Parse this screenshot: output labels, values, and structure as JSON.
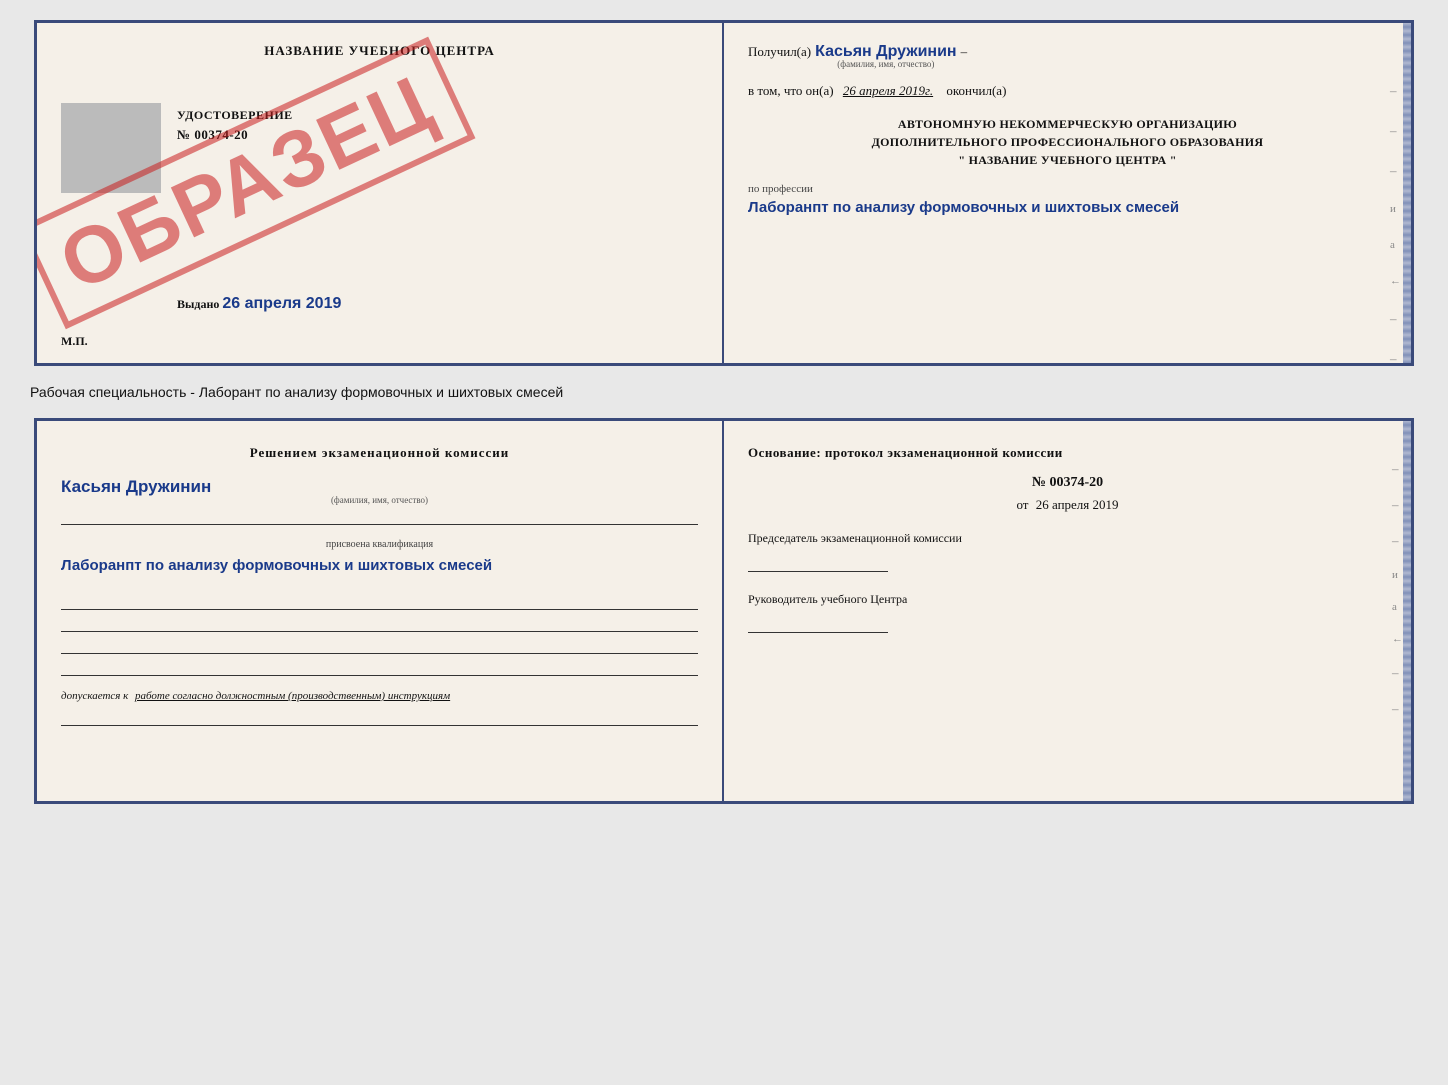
{
  "topDoc": {
    "left": {
      "title": "НАЗВАНИЕ УЧЕБНОГО ЦЕНТРА",
      "grayBox": true,
      "udostLabel": "УДОСТОВЕРЕНИЕ",
      "numberLabel": "№ 00374-20",
      "vydanoLabel": "Выдано",
      "vydanoDate": "26 апреля 2019",
      "mpLabel": "М.П.",
      "obrazets": "ОБРАЗЕЦ"
    },
    "right": {
      "poluchilLabel": "Получил(а)",
      "fio": "Касьян Дружинин",
      "fioSubLabel": "(фамилия, имя, отчество)",
      "dash": "–",
      "vtomLabel": "в том, что он(а)",
      "date": "26 апреля 2019г.",
      "okonchilLabel": "окончил(а)",
      "avtonom1": "АВТОНОМНУЮ НЕКОММЕРЧЕСКУЮ ОРГАНИЗАЦИЮ",
      "avtonom2": "ДОПОЛНИТЕЛЬНОГО ПРОФЕССИОНАЛЬНОГО ОБРАЗОВАНИЯ",
      "avtonom3": "\"   НАЗВАНИЕ УЧЕБНОГО ЦЕНТРА   \"",
      "proprofessiLabel": "по профессии",
      "profession": "Лаборанпт по анализу формовочных и шихтовых смесей",
      "rightDashes": [
        "-",
        "-",
        "-",
        "и",
        "а",
        "←",
        "-",
        "-"
      ]
    }
  },
  "specialtyText": "Рабочая специальность - Лаборант по анализу формовочных и шихтовых смесей",
  "bottomDoc": {
    "left": {
      "resheniemTitle": "Решением экзаменационной комиссии",
      "kasyan": "Касьян Дружинин",
      "fioSubLabel": "(фамилия, имя, отчество)",
      "prisvoenaLabel": "присвоена квалификация",
      "qualification": "Лаборанпт по анализу формовочных и шихтовых смесей",
      "dopuskaetsyaLabel": "допускается к",
      "dopuskaetsyaText": "работе согласно должностным (производственным) инструкциям"
    },
    "right": {
      "osnovaniTitle": "Основание: протокол экзаменационной комиссии",
      "numberLabel": "№ 00374-20",
      "otLabel": "от",
      "otDate": "26 апреля 2019",
      "predsedatelLabel": "Председатель экзаменационной комиссии",
      "rukovoditelLabel": "Руководитель учебного Центра",
      "rightDashes": [
        "-",
        "-",
        "-",
        "и",
        "а",
        "←",
        "-",
        "-"
      ]
    }
  }
}
